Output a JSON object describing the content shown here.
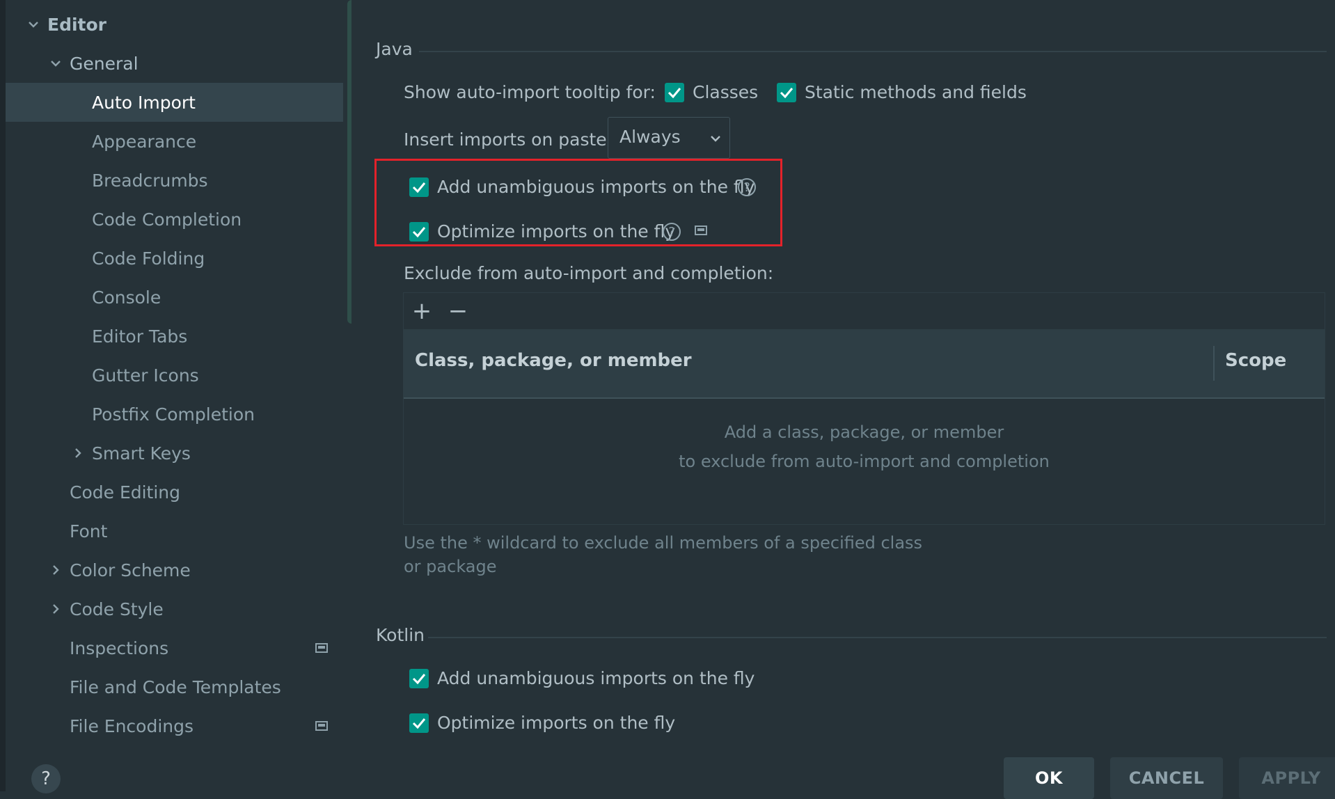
{
  "sidebar": {
    "items": [
      {
        "label": "Editor",
        "kind": "expanded"
      },
      {
        "label": "General",
        "kind": "expanded"
      },
      {
        "label": "Auto Import",
        "kind": "selected"
      },
      {
        "label": "Appearance"
      },
      {
        "label": "Breadcrumbs"
      },
      {
        "label": "Code Completion"
      },
      {
        "label": "Code Folding"
      },
      {
        "label": "Console"
      },
      {
        "label": "Editor Tabs"
      },
      {
        "label": "Gutter Icons"
      },
      {
        "label": "Postfix Completion"
      },
      {
        "label": "Smart Keys",
        "kind": "collapsed"
      },
      {
        "label": "Code Editing"
      },
      {
        "label": "Font"
      },
      {
        "label": "Color Scheme",
        "kind": "collapsed"
      },
      {
        "label": "Code Style",
        "kind": "collapsed"
      },
      {
        "label": "Inspections",
        "icon": "project-scope-icon"
      },
      {
        "label": "File and Code Templates"
      },
      {
        "label": "File Encodings",
        "icon": "project-scope-icon"
      }
    ],
    "help": "?"
  },
  "java": {
    "title": "Java",
    "tooltip_label": "Show auto-import tooltip for:",
    "classes_label": "Classes",
    "classes_checked": true,
    "static_label": "Static methods and fields",
    "static_checked": true,
    "paste_label": "Insert imports on paste:",
    "paste_value": "Always",
    "unambiguous_label": "Add unambiguous imports on the fly",
    "unambiguous_checked": true,
    "optimize_label": "Optimize imports on the fly",
    "optimize_checked": true,
    "exclude_label": "Exclude from auto-import and completion:",
    "table": {
      "add": "+",
      "remove": "−",
      "columns": [
        "Class, package, or member",
        "Scope"
      ],
      "empty_line1": "Add a class, package, or member",
      "empty_line2": "to exclude from auto-import and completion"
    },
    "hint": "Use the * wildcard to exclude all members of a specified class or package"
  },
  "kotlin": {
    "title": "Kotlin",
    "unambiguous_label": "Add unambiguous imports on the fly",
    "unambiguous_checked": true,
    "optimize_label": "Optimize imports on the fly",
    "optimize_checked": true
  },
  "buttons": {
    "ok": "OK",
    "cancel": "CANCEL",
    "apply": "APPLY"
  },
  "colors": {
    "accent": "#009688",
    "highlight_box": "#e3222a",
    "background": "#263238"
  }
}
